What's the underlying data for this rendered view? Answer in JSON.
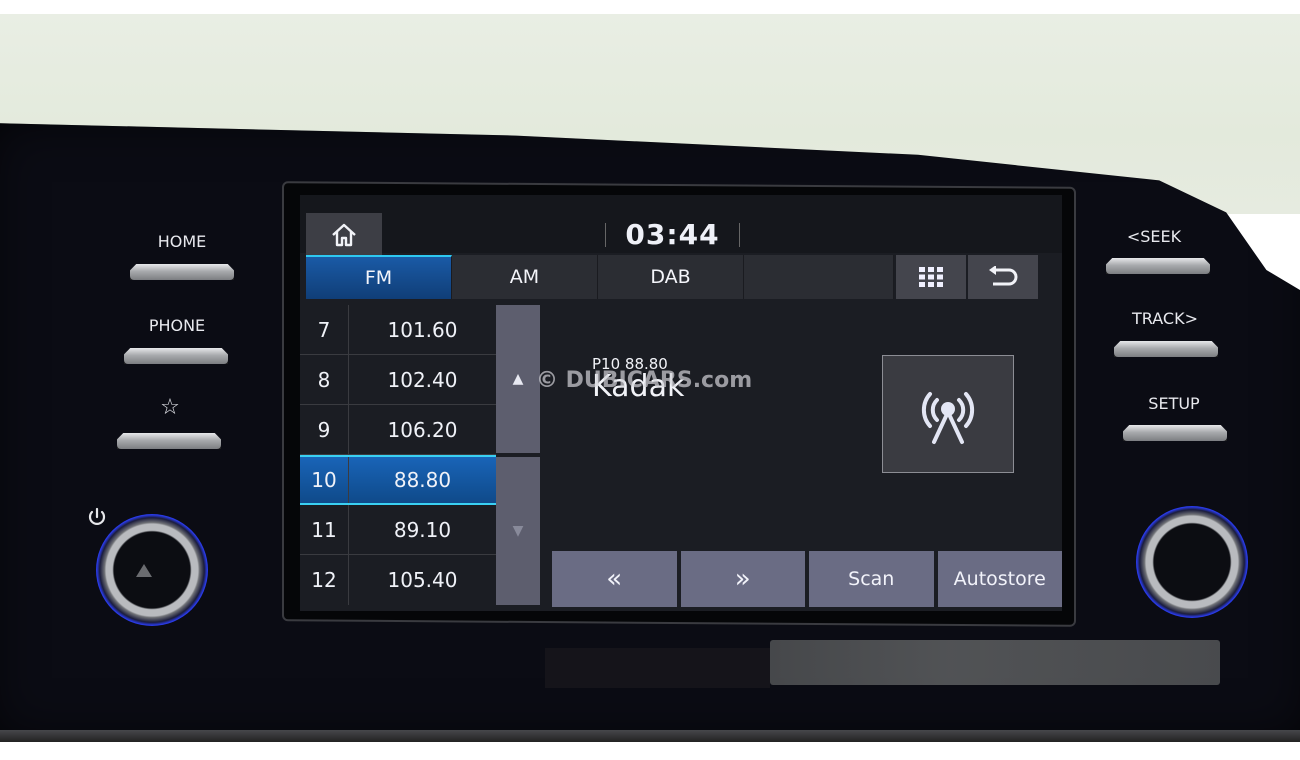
{
  "status": {
    "clock": "03:44"
  },
  "tabs": [
    {
      "label": "FM",
      "active": true
    },
    {
      "label": "AM",
      "active": false
    },
    {
      "label": "DAB",
      "active": false
    }
  ],
  "toolbar": {
    "menu_icon": "grid-menu-icon",
    "back_icon": "back-arrow-icon",
    "home_icon": "home-icon"
  },
  "presets": [
    {
      "num": "7",
      "freq": "101.60"
    },
    {
      "num": "8",
      "freq": "102.40"
    },
    {
      "num": "9",
      "freq": "106.20"
    },
    {
      "num": "10",
      "freq": "88.80",
      "active": true
    },
    {
      "num": "11",
      "freq": "89.10"
    },
    {
      "num": "12",
      "freq": "105.40"
    }
  ],
  "scroll": {
    "up": "▲",
    "down": "▼"
  },
  "now_playing": {
    "meta": "P10  88.80",
    "station": "Kadak",
    "art_icon": "radio-antenna-icon"
  },
  "controls": {
    "prev": "«",
    "next": "»",
    "scan": "Scan",
    "autostore": "Autostore"
  },
  "hardware": {
    "left": [
      "HOME",
      "PHONE",
      "☆"
    ],
    "right": [
      "<SEEK",
      "TRACK>",
      "SETUP"
    ]
  },
  "watermark": "© DUBICARS.com"
}
